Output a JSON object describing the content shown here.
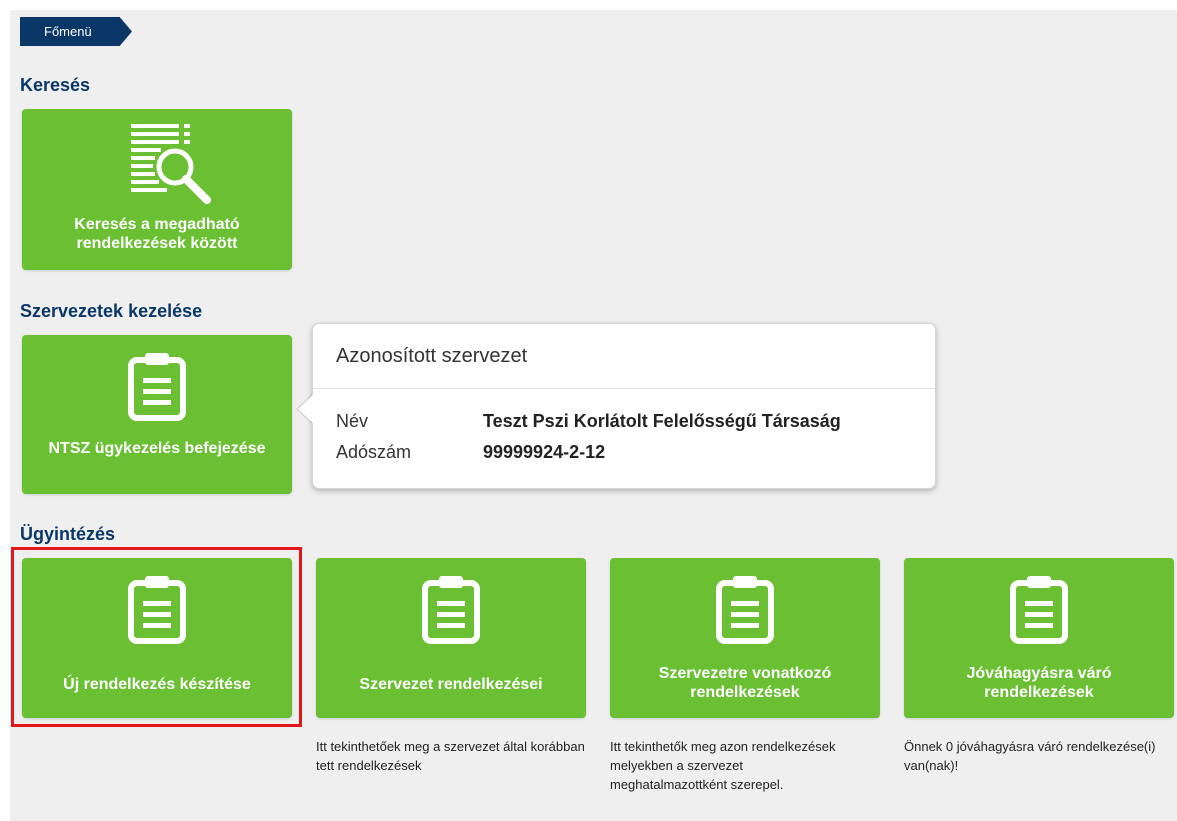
{
  "breadcrumb": {
    "label": "Főmenü"
  },
  "sections": {
    "search": "Keresés",
    "orgs": "Szervezetek kezelése",
    "cases": "Ügyintézés"
  },
  "tiles": {
    "search": {
      "label": "Keresés a megadható rendelkezések között",
      "icon": "document-search-icon"
    },
    "ntsz": {
      "label": "NTSZ ügykezelés befejezése",
      "icon": "clipboard-icon"
    },
    "new": {
      "label": "Új rendelkezés készítése",
      "icon": "clipboard-icon"
    },
    "org_decl": {
      "label": "Szervezet rendelkezései",
      "icon": "clipboard-icon"
    },
    "related": {
      "label": "Szervezetre vonatkozó rendelkezések",
      "icon": "clipboard-icon"
    },
    "approval": {
      "label": "Jóváhagyásra váró rendelkezések",
      "icon": "clipboard-icon"
    }
  },
  "descriptions": {
    "org_decl": "Itt tekinthetőek meg a szervezet által korábban tett rendelkezések",
    "related": "Itt tekinthetők meg azon rendelkezések melyekben a szervezet meghatalmazottként szerepel.",
    "approval": "Önnek 0 jóváhagyásra váró rendelkezése(i) van(nak)!"
  },
  "popup": {
    "title": "Azonosított szervezet",
    "name_label": "Név",
    "name_value": "Teszt Pszi Korlátolt Felelősségű Társaság",
    "tax_label": "Adószám",
    "tax_value": "99999924-2-12"
  },
  "colors": {
    "tile_green": "#6abf32",
    "header_navy": "#0a3768",
    "highlight_red": "#e3161b"
  }
}
